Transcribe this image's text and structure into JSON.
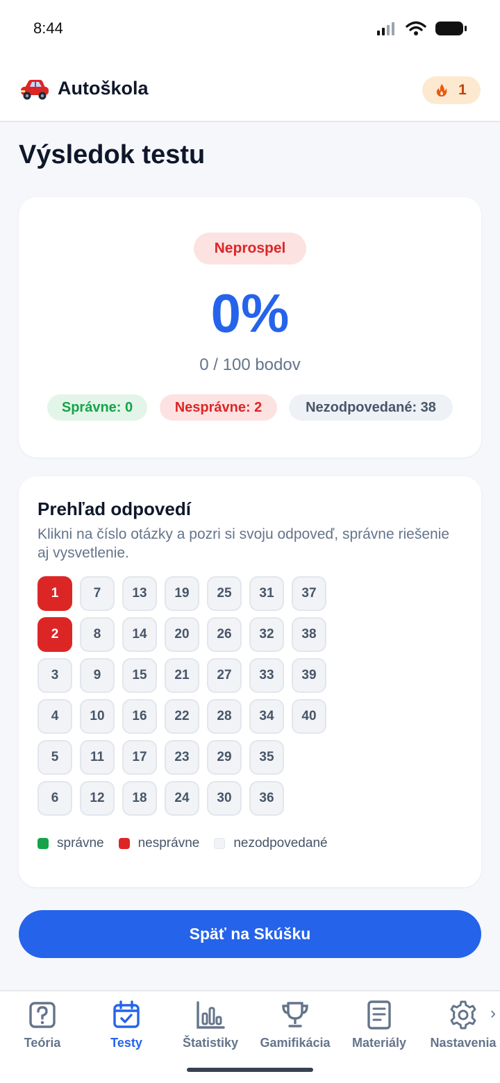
{
  "status_bar": {
    "time": "8:44"
  },
  "header": {
    "title": "Autoškola",
    "streak": "1"
  },
  "page": {
    "title": "Výsledok testu"
  },
  "result": {
    "verdict": "Neprospel",
    "percent": "0%",
    "points": "0 / 100 bodov",
    "correct": "Správne: 0",
    "wrong": "Nesprávne: 2",
    "unanswered": "Nezodpovedané: 38"
  },
  "overview": {
    "title": "Prehľad odpovedí",
    "description": "Klikni na číslo otázky a pozri si svoju odpoveď, správne riešenie aj vysvetlenie.",
    "questions": [
      {
        "n": "1",
        "status": "wrong"
      },
      {
        "n": "2",
        "status": "wrong"
      },
      {
        "n": "3",
        "status": "unanswered"
      },
      {
        "n": "4",
        "status": "unanswered"
      },
      {
        "n": "5",
        "status": "unanswered"
      },
      {
        "n": "6",
        "status": "unanswered"
      },
      {
        "n": "7",
        "status": "unanswered"
      },
      {
        "n": "8",
        "status": "unanswered"
      },
      {
        "n": "9",
        "status": "unanswered"
      },
      {
        "n": "10",
        "status": "unanswered"
      },
      {
        "n": "11",
        "status": "unanswered"
      },
      {
        "n": "12",
        "status": "unanswered"
      },
      {
        "n": "13",
        "status": "unanswered"
      },
      {
        "n": "14",
        "status": "unanswered"
      },
      {
        "n": "15",
        "status": "unanswered"
      },
      {
        "n": "16",
        "status": "unanswered"
      },
      {
        "n": "17",
        "status": "unanswered"
      },
      {
        "n": "18",
        "status": "unanswered"
      },
      {
        "n": "19",
        "status": "unanswered"
      },
      {
        "n": "20",
        "status": "unanswered"
      },
      {
        "n": "21",
        "status": "unanswered"
      },
      {
        "n": "22",
        "status": "unanswered"
      },
      {
        "n": "23",
        "status": "unanswered"
      },
      {
        "n": "24",
        "status": "unanswered"
      },
      {
        "n": "25",
        "status": "unanswered"
      },
      {
        "n": "26",
        "status": "unanswered"
      },
      {
        "n": "27",
        "status": "unanswered"
      },
      {
        "n": "28",
        "status": "unanswered"
      },
      {
        "n": "29",
        "status": "unanswered"
      },
      {
        "n": "30",
        "status": "unanswered"
      },
      {
        "n": "31",
        "status": "unanswered"
      },
      {
        "n": "32",
        "status": "unanswered"
      },
      {
        "n": "33",
        "status": "unanswered"
      },
      {
        "n": "34",
        "status": "unanswered"
      },
      {
        "n": "35",
        "status": "unanswered"
      },
      {
        "n": "36",
        "status": "unanswered"
      },
      {
        "n": "37",
        "status": "unanswered"
      },
      {
        "n": "38",
        "status": "unanswered"
      },
      {
        "n": "39",
        "status": "unanswered"
      },
      {
        "n": "40",
        "status": "unanswered"
      }
    ],
    "legend": {
      "correct": "správne",
      "wrong": "nesprávne",
      "unanswered": "nezodpovedané"
    }
  },
  "back_button": "Späť na Skúšku",
  "nav": {
    "items": [
      {
        "label": "Teória",
        "icon": "question-icon",
        "active": false
      },
      {
        "label": "Testy",
        "icon": "calendar-check-icon",
        "active": true
      },
      {
        "label": "Štatistiky",
        "icon": "bar-chart-icon",
        "active": false
      },
      {
        "label": "Gamifikácia",
        "icon": "trophy-icon",
        "active": false
      },
      {
        "label": "Materiály",
        "icon": "document-icon",
        "active": false
      },
      {
        "label": "Nastavenia",
        "icon": "gear-icon",
        "active": false
      }
    ]
  },
  "colors": {
    "accent": "#2563eb",
    "correct": "#16a34a",
    "wrong": "#dc2626",
    "streak": "#c2410c"
  }
}
